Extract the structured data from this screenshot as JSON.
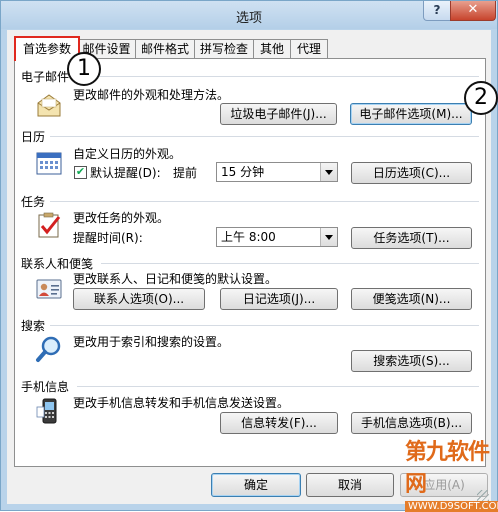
{
  "window": {
    "title": "选项",
    "help_label": "?",
    "close_label": "✕"
  },
  "tabs": [
    "首选参数",
    "邮件设置",
    "邮件格式",
    "拼写检查",
    "其他",
    "代理"
  ],
  "sections": {
    "email": {
      "title": "电子邮件",
      "description": "更改邮件的外观和处理方法。",
      "junk_button": "垃圾电子邮件(J)...",
      "options_button": "电子邮件选项(M)..."
    },
    "calendar": {
      "title": "日历",
      "description": "自定义日历的外观。",
      "reminder_label": "默认提醒(D):",
      "reminder_checked": true,
      "before_label": "提前",
      "reminder_value": "15 分钟",
      "options_button": "日历选项(C)..."
    },
    "tasks": {
      "title": "任务",
      "description": "更改任务的外观。",
      "reminder_time_label": "提醒时间(R):",
      "reminder_time_value": "上午 8:00",
      "options_button": "任务选项(T)..."
    },
    "contacts": {
      "title": "联系人和便笺",
      "description": "更改联系人、日记和便笺的默认设置。",
      "contacts_button": "联系人选项(O)...",
      "journal_button": "日记选项(J)...",
      "notes_button": "便笺选项(N)..."
    },
    "search": {
      "title": "搜索",
      "description": "更改用于索引和搜索的设置。",
      "options_button": "搜索选项(S)..."
    },
    "mobile": {
      "title": "手机信息",
      "description": "更改手机信息转发和手机信息发送设置。",
      "forward_button": "信息转发(F)...",
      "options_button": "手机信息选项(B)..."
    }
  },
  "annotations": {
    "marker1": "1",
    "marker2": "2"
  },
  "watermark": {
    "text": "第九软件网",
    "url": "WWW.D9SOFT.COM"
  },
  "footer": {
    "ok": "确定",
    "cancel": "取消",
    "apply": "应用(A)"
  },
  "colors": {
    "accent_red": "#e0281e",
    "title_bar": "#b9d3ea",
    "watermark": "#e06a1a"
  }
}
